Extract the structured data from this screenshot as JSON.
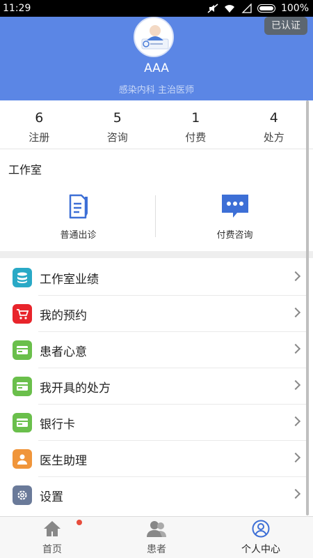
{
  "status_bar": {
    "time": "11:29",
    "battery": "100%"
  },
  "header": {
    "verified_badge": "已认证",
    "doctor_name": "AAA",
    "doctor_dept_title": "感染内科  主治医师"
  },
  "stats": [
    {
      "value": "6",
      "label": "注册"
    },
    {
      "value": "5",
      "label": "咨询"
    },
    {
      "value": "1",
      "label": "付费"
    },
    {
      "value": "4",
      "label": "处方"
    }
  ],
  "studio": {
    "title": "工作室",
    "items": [
      {
        "label": "普通出诊",
        "icon": "document-edit-icon"
      },
      {
        "label": "付费咨询",
        "icon": "chat-bubble-icon"
      }
    ]
  },
  "menu": [
    {
      "label": "工作室业绩",
      "icon": "database-icon",
      "color": "#29a9c6"
    },
    {
      "label": "我的预约",
      "icon": "cart-icon",
      "color": "#e8242b"
    },
    {
      "label": "患者心意",
      "icon": "card-icon",
      "color": "#6abf4b"
    },
    {
      "label": "我开具的处方",
      "icon": "card-icon",
      "color": "#6abf4b"
    },
    {
      "label": "银行卡",
      "icon": "card-icon",
      "color": "#6abf4b"
    },
    {
      "label": "医生助理",
      "icon": "person-icon",
      "color": "#f0953a"
    },
    {
      "label": "设置",
      "icon": "gear-icon",
      "color": "#6a7a99"
    }
  ],
  "tabs": [
    {
      "label": "首页",
      "icon": "home-icon"
    },
    {
      "label": "患者",
      "icon": "patients-icon"
    },
    {
      "label": "个人中心",
      "icon": "profile-icon"
    }
  ],
  "colors": {
    "header_bg": "#5b86e5",
    "accent": "#3d6fd6"
  }
}
